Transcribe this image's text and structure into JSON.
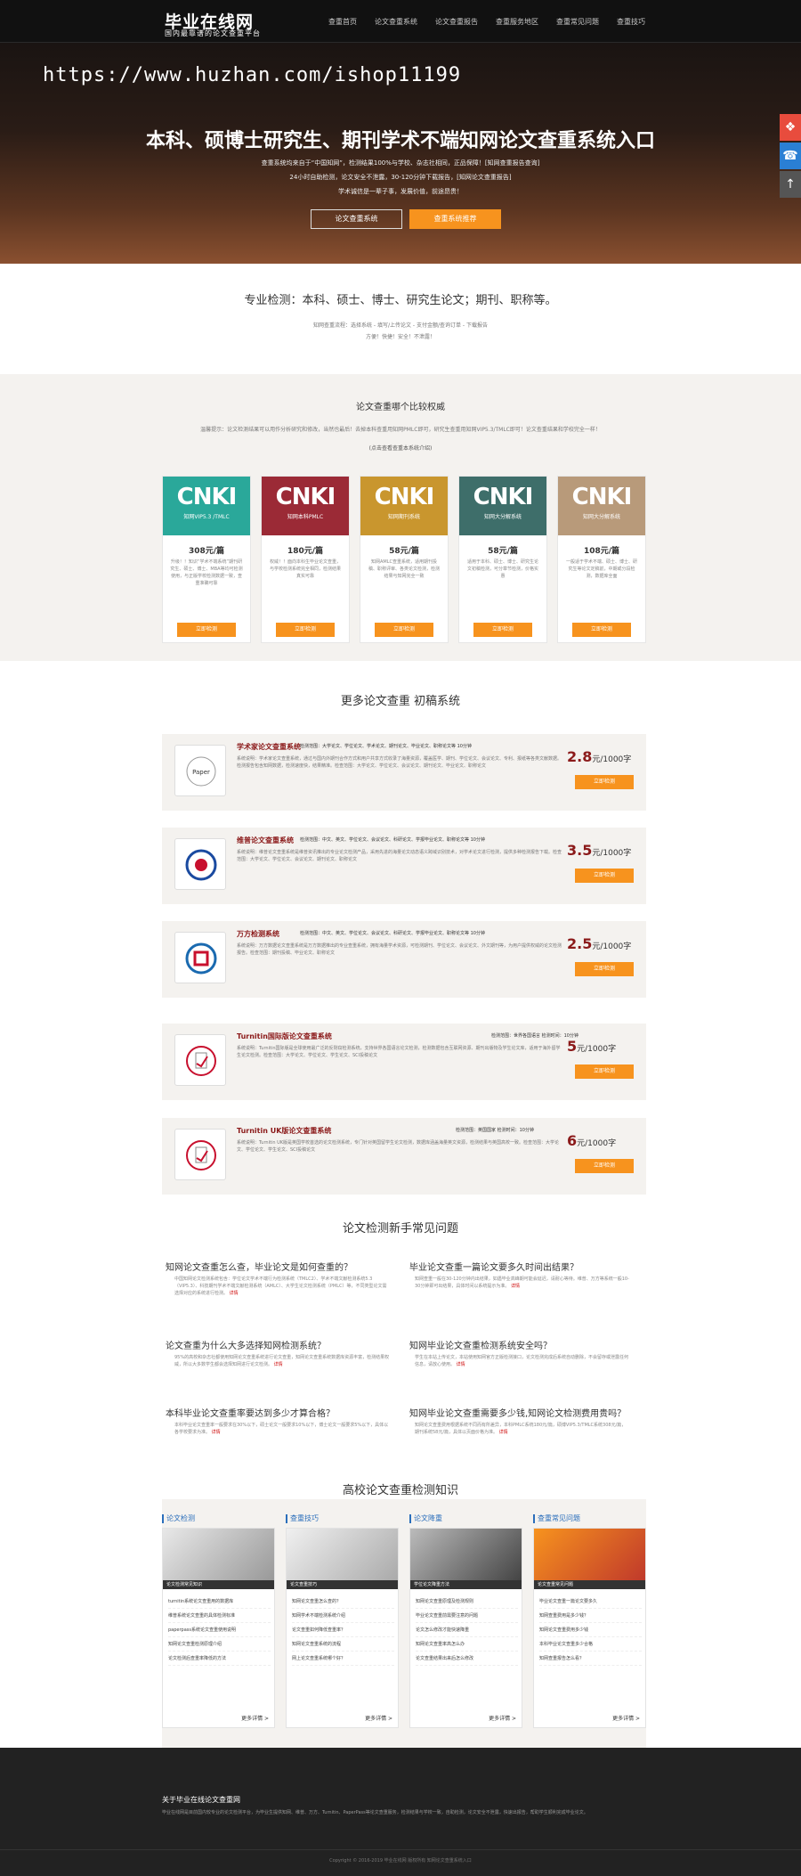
{
  "header": {
    "logo": "毕业在线网",
    "logo_sub": "国内最靠谱的论文查重平台",
    "nav": [
      "查重首页",
      "论文查重系统",
      "论文查重报告",
      "查重服务地区",
      "查重常见问题",
      "查重技巧"
    ]
  },
  "hero": {
    "watermark": "https://www.huzhan.com/ishop11199",
    "title": "本科、硕博士研究生、期刊学术不端知网论文查重系统入口",
    "line1": "查重系统均来自于“中国知网”，检测结果100%与学校、杂志社相同，正品保障！[知网查重报告查询]",
    "line2": "24小时自助检测，论文安全不泄露，30-120分钟下载报告，[知网论文查重报告]",
    "line3": "学术诚信是一辈子事，发展价值，前途昂贵！",
    "btn_outline": "论文查重系统",
    "btn_orange": "查重系统推荐"
  },
  "side_tools": [
    "❖",
    "☎",
    "↑"
  ],
  "intro": {
    "title": "专业检测：本科、硕士、博士、研究生论文；期刊、职称等。",
    "line1": "知网查重流程：选择系统 - 填写/上传论文 - 支付金额/查询订单 - 下载报告",
    "line2": "方便！快捷！安全！不泄露！"
  },
  "authority": {
    "title": "论文查重哪个比较权威",
    "sub": "温馨提示：论文检测结果可以用作分析研究和修改，当然也最后！去掉本科查重用知网PMLC即可，研究生查重用知网VIP5.3/TMLC即可！论文查重结果和学校完全一样！",
    "note": "(点击查看查重本系统介绍)"
  },
  "cards": [
    {
      "logo": "CNKI",
      "caption": "知网VIP5.3 /TMLC",
      "price": "308元/篇",
      "desc": "升级！！知识“学术不端系统”期刊研究生、硕士、博士、MBA等均可检测使用，与正版学校检测数据一致，查重准确可靠",
      "btn": "立即检测",
      "color": "#2aa89a"
    },
    {
      "logo": "CNKI",
      "caption": "知网本科PMLC",
      "price": "180元/篇",
      "desc": "权威！！面向本科生毕业论文查重，与学校检测系统完全相同，检测结果真实可靠",
      "btn": "立即检测",
      "color": "#9b2a36"
    },
    {
      "logo": "CNKI",
      "caption": "知网期刊系统",
      "price": "58元/篇",
      "desc": "知网AMLC查重系统，适用期刊投稿、职称评审、各类论文检测，检测结果与知网完全一致",
      "btn": "立即检测",
      "color": "#c9962e"
    },
    {
      "logo": "CNKI",
      "caption": "知网大分解系统",
      "price": "58元/篇",
      "desc": "适用于本科、硕士、博士、研究生论文初稿检测，可分章节检测，价格实惠",
      "btn": "立即检测",
      "color": "#3e6e6a"
    },
    {
      "logo": "CNKI",
      "caption": "知网大分解系统",
      "price": "108元/篇",
      "desc": "一般适于学术不端、硕士、博士、研究生等论文定稿前，中期或分段检测，数据库全面",
      "btn": "立即检测",
      "color": "#b89a7a"
    }
  ],
  "more": {
    "title": "更多论文查重 初稿系统"
  },
  "systems": [
    {
      "name": "学术家论文查重系统",
      "meta": "检测范围：大学论文、学位论文、学术论文、期刊论文、毕业论文、职称论文等 10分钟",
      "text": "系统说明：学术家论文查重系统，通过与国内外期刊合作方式和用户共享方式收录了海量资源，覆盖医学、期刊、学位论文、会议论文、专利、报纸等各类文献数据。检测报告包含知网数据，检测速度快，结果精准。检查范围：大学论文、学位论文、会议论文、期刊论文、毕业论文、职称论文",
      "price": "2.8",
      "unit": "元/1000字",
      "btn": "立即检测"
    },
    {
      "name": "维普论文查重系统",
      "meta": "检测范围：中文、英文、学位论文、会议论文、科研论文、学报毕业论文、职称论文等 10分钟",
      "text": "系统说明：维普论文查重系统是维普资讯推出的专业论文检测产品，采用先进的海量论文动态语义跨域识别技术，对学术论文进行检测，提供多种检测报告下载。检查范围：大学论文、学位论文、会议论文、期刊论文、职称论文",
      "price": "3.5",
      "unit": "元/1000字",
      "btn": "立即检测"
    },
    {
      "name": "万方检测系统",
      "meta": "检测范围：中文、英文、学位论文、会议论文、科研论文、学报毕业论文、职称论文等 10分钟",
      "text": "系统说明：万方数据论文查重系统是万方数据推出的专业查重系统，拥有海量学术资源，可检测期刊、学位论文、会议论文、外文期刊等，为用户提供权威的论文检测报告。检查范围：期刊投稿、毕业论文、职称论文",
      "price": "2.5",
      "unit": "元/1000字",
      "btn": "立即检测"
    },
    {
      "name": "Turnitin国际版论文查重系统",
      "meta": "检测范围：世界各国语言 检测时间：10分钟",
      "text": "系统说明：Turnitin国际版是全球使用最广泛的反剽窃检测系统，支持世界各国语言论文检测，检测数据包含互联网资源、期刊出版物及学生论文库，适用于海外留学生论文检测。检查范围：大学论文、学位论文、学生论文、SCI投稿论文",
      "price": "5",
      "unit": "元/1000字",
      "btn": "立即检测"
    },
    {
      "name": "Turnitin UK版论文查重系统",
      "meta": "检测范围：英国国家 检测时间：10分钟",
      "text": "系统说明：Turnitin UK版是英国学校首选的论文检测系统，专门针对英国留学生论文检测，数据库涵盖海量英文资源，检测结果与英国高校一致。检查范围：大学论文、学位论文、学生论文、SCI投稿论文",
      "price": "6",
      "unit": "元/1000字",
      "btn": "立即检测"
    }
  ],
  "faq": {
    "title": "论文检测新手常见问题",
    "items": [
      {
        "q": "知网论文查重怎么查，毕业论文是如何查重的？",
        "a": "中国知网论文检测系统包含：学位论文学术不端行为检测系统（TMLC2）、学术不端文献检测系统5.3（VIP5.3）、科技期刊学术不端文献检测系统（AMLC）、大学生论文检测系统（PMLC）等，不同类型论文需选择对应的系统进行检测。",
        "more": "详情"
      },
      {
        "q": "毕业论文查重一篇论文要多久时间出结果？",
        "a": "知网查重一般在30-120分钟内出结果，如遇毕业高峰期可能会延迟，请耐心等待。维普、万方等系统一般10-30分钟即可出结果，具体时间以系统提示为准。",
        "more": "详情"
      },
      {
        "q": "论文查重为什么大多选择知网检测系统？",
        "a": "95%的高校和杂志社都使用知网论文查重系统进行论文查重，知网论文查重系统数据库资源丰富，检测结果权威，所以大多数学生都会选择知网进行论文检测。",
        "more": "详情"
      },
      {
        "q": "知网毕业论文查重检测系统安全吗？",
        "a": "学生在本站上传论文，本站使用知网官方正版检测接口，论文检测完成后系统自动删除，不会留存或泄露任何信息，请放心使用。",
        "more": "详情"
      },
      {
        "q": "本科毕业论文查重率要达到多少才算合格？",
        "a": "本科毕业论文查重率一般要求在30%以下，硕士论文一般要求10%以下，博士论文一般要求5%以下，具体以各学校要求为准。",
        "more": "详情"
      },
      {
        "q": "知网毕业论文查重需要多少钱,知网论文检测费用贵吗？",
        "a": "知网论文查重费用根据系统不同而有所差异，本科PMLC系统180元/篇，硕博VIP5.3/TMLC系统308元/篇，期刊系统58元/篇，具体以页面价格为准。",
        "more": "详情"
      }
    ]
  },
  "knowledge": {
    "title": "高校论文查重检测知识",
    "columns": [
      {
        "head": "论文检测",
        "cap": "论文检测常见知识",
        "items": [
          "turnitin系统论文查重用的数据库",
          "维普系统论文查重的具体检测标准",
          "paperpass系统论文查重使用说明",
          "知网论文查重检测原理介绍",
          "论文检测后查重率降低的方法"
        ],
        "more": "更多详情 >"
      },
      {
        "head": "查重技巧",
        "cap": "论文查重技巧",
        "items": [
          "知网论文查重怎么查的？",
          "知网学术不端检测系统介绍",
          "论文查重如何降低查重率？",
          "知网论文查重系统的流程",
          "网上论文查重系统哪个好？"
        ],
        "more": "更多详情 >"
      },
      {
        "head": "论文降重",
        "cap": "学位论文降重方法",
        "items": [
          "知网论文查重原理及检测规则",
          "毕业论文查重前需要注意的问题",
          "论文怎么修改才能快速降重",
          "知网论文查重率高怎么办",
          "论文查重结果出来后怎么修改"
        ],
        "more": "更多详情 >"
      },
      {
        "head": "查重常见问题",
        "cap": "论文查重常见问题",
        "items": [
          "毕业论文查重一篇论文要多久",
          "知网查重费用是多少钱？",
          "知网论文查重费用多少钱",
          "本科毕业论文查重多少合格",
          "知网查重报告怎么看？"
        ],
        "more": "更多详情 >"
      }
    ]
  },
  "footer": {
    "title": "关于毕业在线论文查重网",
    "text": "毕业在线网是目前国内较专业的论文检测平台，为毕业生提供知网、维普、万方、Turnitin、PaperPass等论文查重服务，检测结果与学校一致，自助检测，论文安全不泄露，快速出报告，帮助学生顺利完成毕业论文。",
    "copy": "Copyright © 2016-2019 毕业在线网 版权所有 知网论文查重系统入口"
  }
}
